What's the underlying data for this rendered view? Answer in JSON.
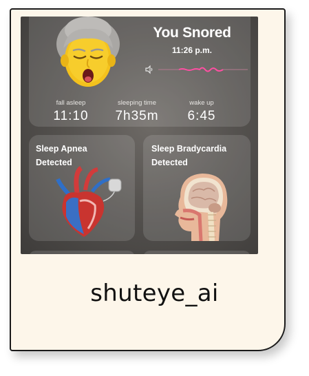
{
  "snore": {
    "title": "You Snored",
    "time": "11:26 p.m."
  },
  "stats": [
    {
      "label": "fall asleep",
      "value": "11:10"
    },
    {
      "label": "sleeping time",
      "value": "7h35m"
    },
    {
      "label": "wake up",
      "value": "6:45"
    }
  ],
  "tiles": {
    "apnea": {
      "line1": "Sleep Apnea",
      "line2": "Detected"
    },
    "bradycardia": {
      "line1": "Sleep Bradycardia",
      "line2": "Detected"
    }
  },
  "caption": "shuteye_ai",
  "icons": {
    "avatar": "snoring-grandmother-icon",
    "speaker": "speaker-icon",
    "heart": "heart-pacemaker-icon",
    "head": "head-anatomy-icon"
  },
  "colors": {
    "card_bg": "#fdf6ea",
    "waveform": "#ff4fa3",
    "screen_bg": "#55524f"
  }
}
